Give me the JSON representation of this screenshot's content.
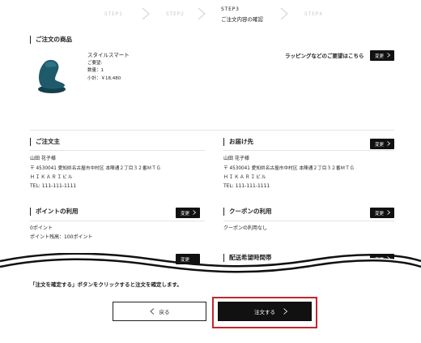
{
  "steps": {
    "step1": "STEP1",
    "step2": "STEP2",
    "step3": "STEP3",
    "step3_label": "ご注文内容の確認",
    "step4": "STEP4"
  },
  "product_section": {
    "title": "ご注文の商品",
    "name": "スタイルスマート",
    "request": "ご要望:",
    "quantity": "数量：1",
    "subtotal": "小計：￥18,480",
    "wrapping_text": "ラッピングなどのご要望はこちら",
    "change_label": "変更"
  },
  "orderer": {
    "title": "ご注文主",
    "name": "山田 花子様",
    "address1": "〒 4530041 愛知県名古屋市中村区 本陣通２丁目３２番ＭＴＧ",
    "address2": "ＨＩＫＡＲＩビル",
    "tel": "TEL: 111-111-1111"
  },
  "delivery": {
    "title": "お届け先",
    "change_label": "変更",
    "name": "山田 花子様",
    "address1": "〒 4530041 愛知県名古屋市中村区 本陣通２丁目３２番ＭＴＧ",
    "address2": "ＨＩＫＡＲＩビル",
    "tel": "TEL: 111-111-1111"
  },
  "points": {
    "title": "ポイントの利用",
    "change_label": "変更",
    "used": "0ポイント",
    "balance": "ポイント残高：100ポイント"
  },
  "coupon": {
    "title": "クーポンの利用",
    "change_label": "変更",
    "status": "クーポンの利用なし"
  },
  "delivery_time": {
    "title": "配送希望時間帯",
    "change_label": "変更",
    "left_change_label": "変更"
  },
  "notice": "「注文を確定する」ボタンをクリックすると注文を確定します。",
  "buttons": {
    "back": "戻る",
    "order": "注文する"
  },
  "colors": {
    "accent_frame": "#c0282d",
    "button_dark": "#111111",
    "chair": "#1f5a6b"
  },
  "icons": [
    "chevron-right-icon",
    "chevron-left-icon"
  ]
}
